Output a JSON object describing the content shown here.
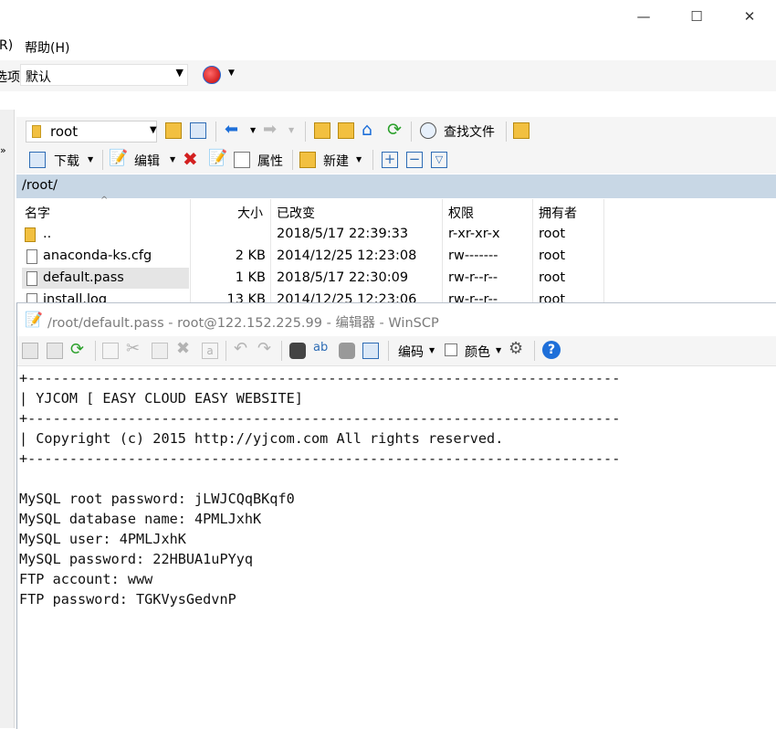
{
  "window": {
    "minimize_glyph": "—",
    "maximize_glyph": "☐",
    "close_glyph": "✕"
  },
  "menu": {
    "partial_left": "R)",
    "help": "帮助(H)"
  },
  "options": {
    "label": "选项",
    "value": "默认"
  },
  "toolbar1": {
    "dir_value": "root",
    "find_files": "查找文件"
  },
  "toolbar2": {
    "download": "下载",
    "edit": "编辑",
    "properties": "属性",
    "new": "新建"
  },
  "path": "/root/",
  "file_list": {
    "columns": [
      "名字",
      "大小",
      "已改变",
      "权限",
      "拥有者"
    ],
    "rows": [
      {
        "name": "..",
        "size": "",
        "modified": "2018/5/17 22:39:33",
        "perms": "r-xr-xr-x",
        "owner": "root"
      },
      {
        "name": "anaconda-ks.cfg",
        "size": "2 KB",
        "modified": "2014/12/25 12:23:08",
        "perms": "rw-------",
        "owner": "root"
      },
      {
        "name": "default.pass",
        "size": "1 KB",
        "modified": "2018/5/17 22:30:09",
        "perms": "rw-r--r--",
        "owner": "root"
      },
      {
        "name": "install.log",
        "size": "13 KB",
        "modified": "2014/12/25 12:23:06",
        "perms": "rw-r--r--",
        "owner": "root"
      }
    ]
  },
  "editor": {
    "title": "/root/default.pass - root@122.152.225.99 - 编辑器 - WinSCP",
    "encoding_label": "编码",
    "color_label": "颜色",
    "lines": [
      "+-----------------------------------------------------------------------",
      "| YJCOM [ EASY CLOUD EASY WEBSITE]",
      "+-----------------------------------------------------------------------",
      "| Copyright (c) 2015 http://yjcom.com All rights reserved.",
      "+-----------------------------------------------------------------------",
      "",
      "MySQL root password: jLWJCQqBKqf0",
      "MySQL database name: 4PMLJxhK",
      "MySQL user: 4PMLJxhK",
      "MySQL password: 22HBUA1uPYyq",
      "FTP account: www",
      "FTP password: TGKVysGedvnP"
    ]
  },
  "colors": {
    "path_bar": "#c8d7e5",
    "selected_row": "#e5e5e5",
    "accent_blue": "#1e6fd9",
    "green": "#2aa02a",
    "red": "#d32020"
  }
}
